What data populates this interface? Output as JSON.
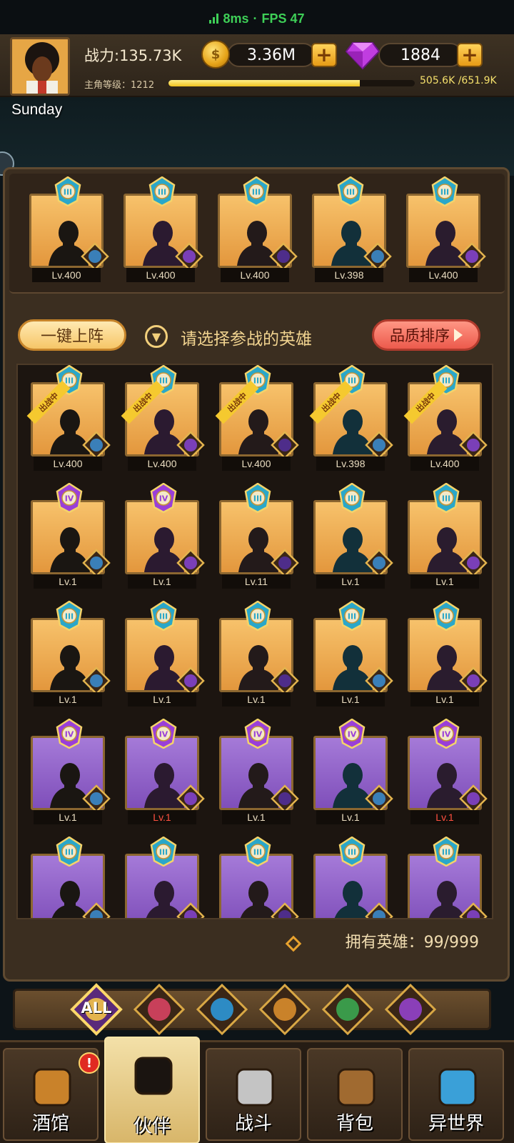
{
  "status": {
    "latency": "8ms",
    "separator": "·",
    "fps": "FPS 47"
  },
  "header": {
    "power": "战力:135.73K",
    "gold": "3.36M",
    "gems": "1884",
    "level_label": "主角等级：1212",
    "xp_text": "505.6K /651.9K",
    "xp_progress": 0.776,
    "player_name": "Sunday"
  },
  "panel": {
    "onekey_button": "一键上阵",
    "hint": "请选择参战的英雄",
    "sort_button": "品质排序",
    "owned_heroes": "拥有英雄：99/999"
  },
  "team": [
    {
      "lv": "Lv.400",
      "rank": "III",
      "bg": "gold"
    },
    {
      "lv": "Lv.400",
      "rank": "III",
      "bg": "gold"
    },
    {
      "lv": "Lv.400",
      "rank": "III",
      "bg": "gold"
    },
    {
      "lv": "Lv.398",
      "rank": "III",
      "bg": "gold"
    },
    {
      "lv": "Lv.400",
      "rank": "III",
      "bg": "gold"
    }
  ],
  "heroes": [
    {
      "lv": "Lv.400",
      "rank": "III",
      "bg": "gold",
      "fighting": "出战中",
      "red": false
    },
    {
      "lv": "Lv.400",
      "rank": "III",
      "bg": "gold",
      "fighting": "出战中",
      "red": false
    },
    {
      "lv": "Lv.400",
      "rank": "III",
      "bg": "gold",
      "fighting": "出战中",
      "red": false
    },
    {
      "lv": "Lv.398",
      "rank": "III",
      "bg": "gold",
      "fighting": "出战中",
      "red": false
    },
    {
      "lv": "Lv.400",
      "rank": "III",
      "bg": "gold",
      "fighting": "出战中",
      "red": false
    },
    {
      "lv": "Lv.1",
      "rank": "IV",
      "bg": "gold",
      "fighting": "",
      "red": false
    },
    {
      "lv": "Lv.1",
      "rank": "IV",
      "bg": "gold",
      "fighting": "",
      "red": false
    },
    {
      "lv": "Lv.11",
      "rank": "III",
      "bg": "gold",
      "fighting": "",
      "red": false
    },
    {
      "lv": "Lv.1",
      "rank": "III",
      "bg": "gold",
      "fighting": "",
      "red": false
    },
    {
      "lv": "Lv.1",
      "rank": "III",
      "bg": "gold",
      "fighting": "",
      "red": false
    },
    {
      "lv": "Lv.1",
      "rank": "III",
      "bg": "gold",
      "fighting": "",
      "red": false
    },
    {
      "lv": "Lv.1",
      "rank": "III",
      "bg": "gold",
      "fighting": "",
      "red": false
    },
    {
      "lv": "Lv.1",
      "rank": "III",
      "bg": "gold",
      "fighting": "",
      "red": false
    },
    {
      "lv": "Lv.1",
      "rank": "III",
      "bg": "gold",
      "fighting": "",
      "red": false
    },
    {
      "lv": "Lv.1",
      "rank": "III",
      "bg": "gold",
      "fighting": "",
      "red": false
    },
    {
      "lv": "Lv.1",
      "rank": "IV",
      "bg": "purple",
      "fighting": "",
      "red": false
    },
    {
      "lv": "Lv.1",
      "rank": "IV",
      "bg": "purple",
      "fighting": "",
      "red": true
    },
    {
      "lv": "Lv.1",
      "rank": "IV",
      "bg": "purple",
      "fighting": "",
      "red": false
    },
    {
      "lv": "Lv.1",
      "rank": "IV",
      "bg": "purple",
      "fighting": "",
      "red": false
    },
    {
      "lv": "Lv.1",
      "rank": "IV",
      "bg": "purple",
      "fighting": "",
      "red": true
    },
    {
      "lv": "",
      "rank": "III",
      "bg": "purple",
      "fighting": "",
      "red": false
    },
    {
      "lv": "",
      "rank": "III",
      "bg": "purple",
      "fighting": "",
      "red": false
    },
    {
      "lv": "",
      "rank": "III",
      "bg": "purple",
      "fighting": "",
      "red": false
    },
    {
      "lv": "",
      "rank": "III",
      "bg": "purple",
      "fighting": "",
      "red": false
    },
    {
      "lv": "",
      "rank": "III",
      "bg": "purple",
      "fighting": "",
      "red": false
    }
  ],
  "filters": [
    {
      "label": "ALL",
      "icon": "all-filter-icon"
    },
    {
      "label": "",
      "icon": "crown-faction-icon"
    },
    {
      "label": "",
      "icon": "monkey-faction-icon"
    },
    {
      "label": "",
      "icon": "lion-faction-icon"
    },
    {
      "label": "",
      "icon": "elf-faction-icon"
    },
    {
      "label": "",
      "icon": "demon-faction-icon"
    }
  ],
  "nav": [
    {
      "label": "酒馆",
      "icon": "beer-mug-icon",
      "badge": "!"
    },
    {
      "label": "伙伴",
      "icon": "partner-avatar-icon",
      "badge": ""
    },
    {
      "label": "战斗",
      "icon": "crossed-swords-icon",
      "badge": ""
    },
    {
      "label": "背包",
      "icon": "treasure-chest-icon",
      "badge": ""
    },
    {
      "label": "异世界",
      "icon": "portal-icon",
      "badge": ""
    }
  ],
  "colors": {
    "gold_card": "#e3973d",
    "purple_card": "#7f4fba",
    "accent": "#f5c92f",
    "sort_red": "#ec5a4c"
  }
}
